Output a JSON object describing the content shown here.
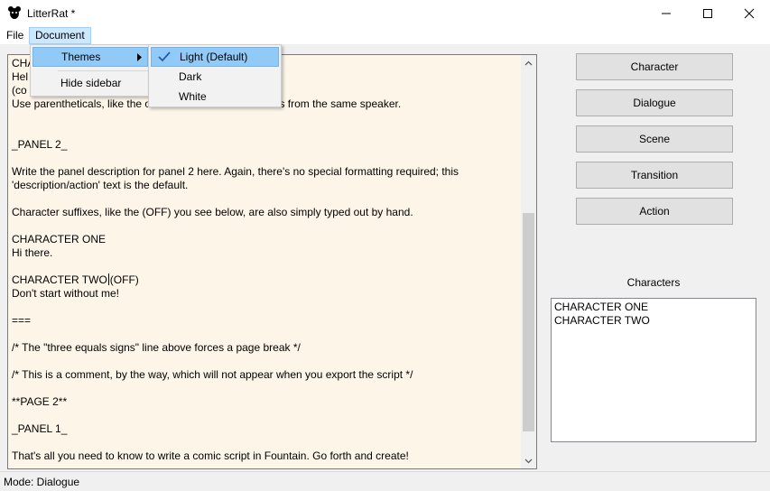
{
  "window": {
    "title": "LitterRat *",
    "icon": "rat-icon",
    "controls": [
      "minimize-icon",
      "maximize-icon",
      "close-icon"
    ]
  },
  "menubar": {
    "file": "File",
    "document": "Document"
  },
  "document_menu": {
    "themes": "Themes",
    "hide_sidebar": "Hide sidebar"
  },
  "themes_menu": {
    "items": [
      "Light (Default)",
      "Dark",
      "White"
    ],
    "selected": "Light (Default)"
  },
  "editor": {
    "lines": [
      "CHA",
      "Hel",
      "(co",
      "Use parentheticals, like the o",
      "lloons from the same speaker.",
      "_PANEL 2_",
      "Write the panel description for panel 2 here. Again, there's no special formatting required; this",
      "'description/action' text is the default.",
      "Character suffixes, like the (OFF) you see below, are also simply typed out by hand.",
      "CHARACTER ONE",
      "Hi there.",
      "CHARACTER TWO",
      "(OFF)",
      "Don't start without me!",
      "===",
      "/* The \"three equals signs\" line above forces a page break */",
      "/* This is a comment, by the way, which will not appear when you export the script */",
      "**PAGE 2**",
      "_PANEL 1_",
      "That's all you need to know to write a comic script in Fountain. Go forth and create!"
    ],
    "background": "#fdf6e8"
  },
  "sidebar": {
    "buttons": [
      "Character",
      "Dialogue",
      "Scene",
      "Transition",
      "Action"
    ],
    "characters_heading": "Characters",
    "characters": [
      "CHARACTER ONE",
      "CHARACTER TWO"
    ]
  },
  "status": {
    "mode": "Mode: Dialogue"
  },
  "colors": {
    "menu_highlight": "#91c9f7",
    "menubar_active": "#cce8ff",
    "check": "#1f5fa8"
  }
}
